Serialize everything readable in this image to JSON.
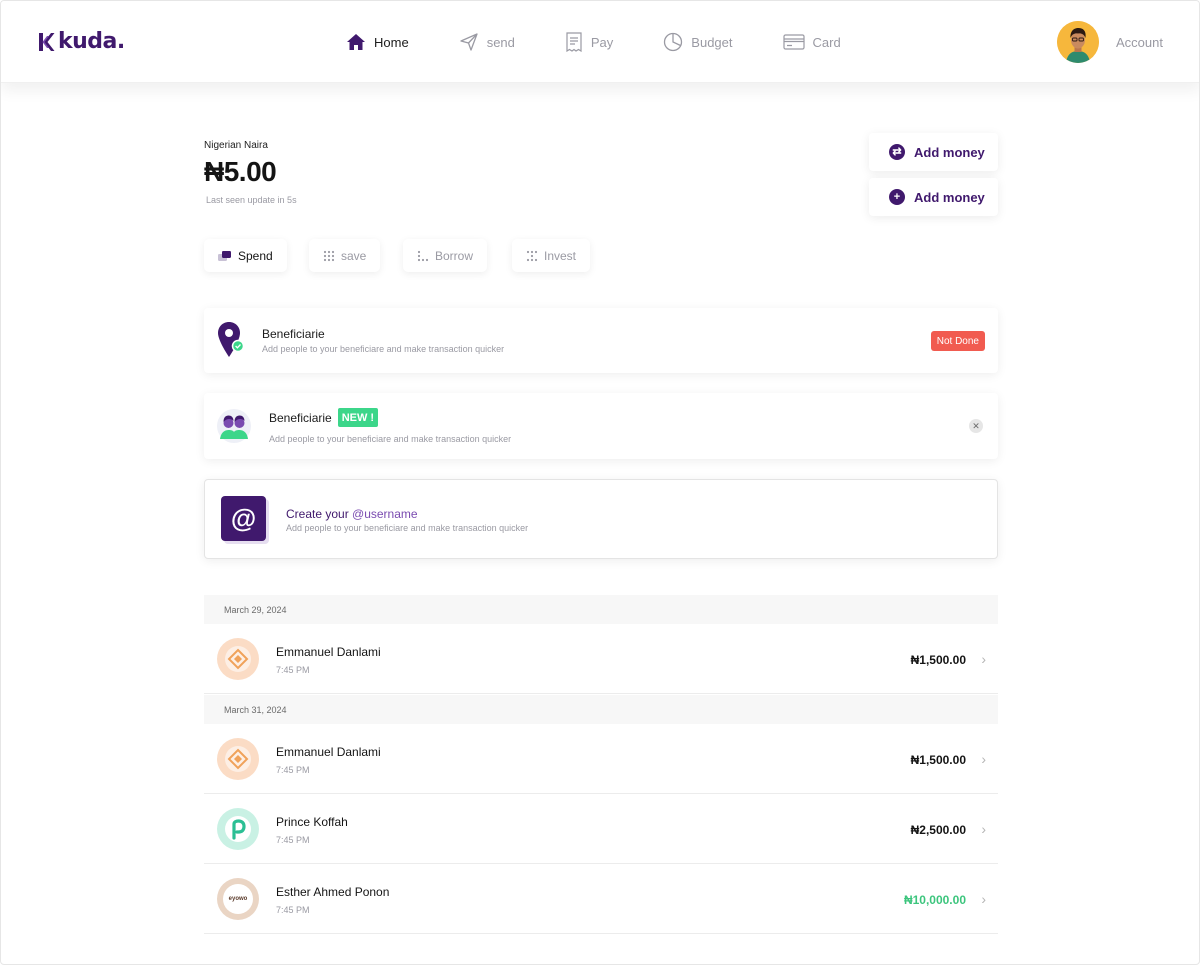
{
  "brand": {
    "name": "kuda.",
    "color": "#40196d"
  },
  "nav": {
    "items": [
      {
        "label": "Home",
        "icon": "home-icon",
        "active": true
      },
      {
        "label": "send",
        "icon": "send-icon"
      },
      {
        "label": "Pay",
        "icon": "receipt-icon"
      },
      {
        "label": "Budget",
        "icon": "pie-chart-icon"
      },
      {
        "label": "Card",
        "icon": "card-icon"
      }
    ],
    "account_label": "Account"
  },
  "balance": {
    "currency_label": "Nigerian Naira",
    "amount": "₦5.00",
    "note": "Last seen update in 5s"
  },
  "actions": {
    "add_money_1": "Add money",
    "add_money_2": "Add money"
  },
  "tabs": [
    {
      "label": "Spend",
      "active": true
    },
    {
      "label": "save"
    },
    {
      "label": "Borrow"
    },
    {
      "label": "Invest"
    }
  ],
  "cards": {
    "beneficiary_1": {
      "title": "Beneficiarie",
      "subtitle": "Add people to your beneficiare and make transaction quicker",
      "status": "Not Done"
    },
    "beneficiary_2": {
      "title": "Beneficiarie",
      "badge": "NEW !",
      "subtitle": "Add people to your beneficiare and make transaction quicker"
    },
    "username": {
      "title_prefix": "Create your ",
      "title_handle": "@username",
      "subtitle": "Add people to your beneficiare and make transaction quicker"
    }
  },
  "transactions": {
    "groups": [
      {
        "date": "March 29, 2024",
        "items": [
          {
            "name": "Emmanuel Danlami",
            "time": "7:45 PM",
            "amount": "₦1,500.00",
            "color": "dark"
          }
        ]
      },
      {
        "date": "March 31, 2024",
        "items": [
          {
            "name": "Emmanuel Danlami",
            "time": "7:45 PM",
            "amount": "₦1,500.00",
            "color": "dark"
          },
          {
            "name": "Prince Koffah",
            "time": "7:45 PM",
            "amount": "₦2,500.00",
            "color": "dark"
          },
          {
            "name": "Esther Ahmed Ponon",
            "time": "7:45 PM",
            "amount": "₦10,000.00",
            "color": "green",
            "logo_text": "eyowo"
          }
        ]
      }
    ]
  },
  "colors": {
    "accent": "#40196d",
    "success": "#3cc57d",
    "danger": "#f15b50",
    "new_badge": "#3cd68a"
  }
}
